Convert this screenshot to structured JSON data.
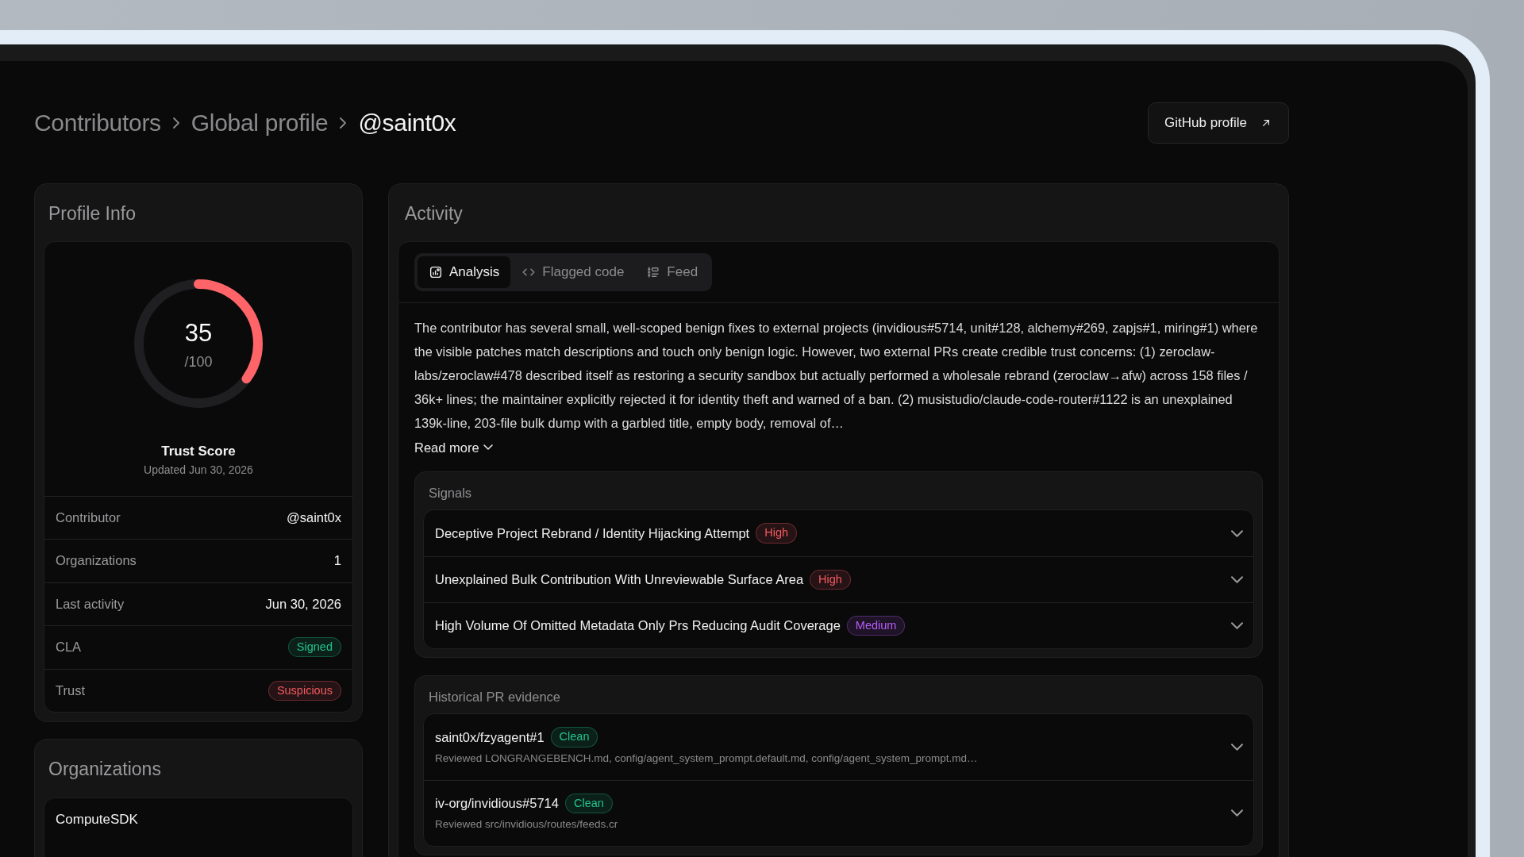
{
  "breadcrumb": [
    {
      "label": "Contributors",
      "current": false
    },
    {
      "label": "Global profile",
      "current": false
    },
    {
      "label": "@saint0x",
      "current": true
    }
  ],
  "github_button": {
    "label": "GitHub profile"
  },
  "profile_info": {
    "title": "Profile Info",
    "score": {
      "value": "35",
      "max": "/100",
      "level": 0.35,
      "label": "Trust Score",
      "updated": "Updated Jun 30, 2026"
    },
    "rows": [
      {
        "label": "Contributor",
        "value": "@saint0x",
        "kind": "text"
      },
      {
        "label": "Organizations",
        "value": "1",
        "kind": "text"
      },
      {
        "label": "Last activity",
        "value": "Jun 30, 2026",
        "kind": "text"
      },
      {
        "label": "CLA",
        "value": "Signed",
        "kind": "badge",
        "color": "#22c48a"
      },
      {
        "label": "Trust",
        "value": "Suspicious",
        "kind": "badge",
        "color": "#f35b60"
      }
    ]
  },
  "organizations": {
    "title": "Organizations",
    "items": [
      {
        "name": "ComputeSDK"
      }
    ]
  },
  "activity": {
    "title": "Activity",
    "tabs": [
      {
        "label": "Analysis",
        "selected": true
      },
      {
        "label": "Flagged code",
        "selected": false
      },
      {
        "label": "Feed",
        "selected": false
      }
    ],
    "summary": "The contributor has several small, well-scoped benign fixes to external projects (invidious#5714, unit#128, alchemy#269, zapjs#1, miring#1) where the visible patches match descriptions and touch only benign logic. However, two external PRs create credible trust concerns: (1) zeroclaw-labs/zeroclaw#478 described itself as restoring a security sandbox but actually performed a wholesale rebrand (zeroclaw→afw) across 158 files / 36k+ lines; the maintainer explicitly rejected it for identity theft and warned of a ban. (2) musistudio/claude-code-router#1122 is an unexplained 139k-line, 203-file bulk dump with a garbled title, empty body, removal of…",
    "read_more": "Read more",
    "signals": {
      "title": "Signals",
      "items": [
        {
          "title": "Deceptive Project Rebrand / Identity Hijacking Attempt",
          "severity": "High",
          "color": "#f35b60",
          "expanded": false
        },
        {
          "title": "Unexplained Bulk Contribution With Unreviewable Surface Area",
          "severity": "High",
          "color": "#f35b60",
          "expanded": false
        },
        {
          "title": "High Volume Of Omitted Metadata Only Prs Reducing Audit Coverage",
          "severity": "Medium",
          "color": "#b65ef5",
          "expanded": false
        }
      ]
    },
    "evidence": {
      "title": "Historical PR evidence",
      "items": [
        {
          "title": "saint0x/fzyagent#1",
          "status": "Clean",
          "color": "#22c48a",
          "detail": "Reviewed LONGRANGEBENCH.md, config/agent_system_prompt.default.md, config/agent_system_prompt.md…",
          "expanded": false
        },
        {
          "title": "iv-org/invidious#5714",
          "status": "Clean",
          "color": "#22c48a",
          "detail": "Reviewed src/invidious/routes/feeds.cr",
          "expanded": false
        }
      ]
    }
  }
}
